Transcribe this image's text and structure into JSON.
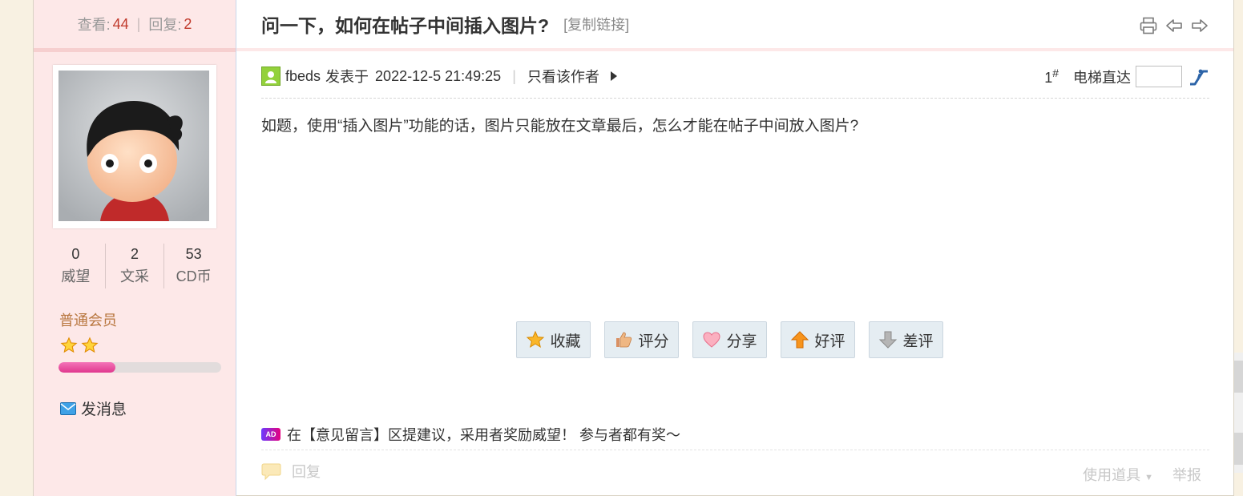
{
  "sidebar": {
    "views_label": "查看:",
    "views": "44",
    "replies_label": "回复:",
    "replies": "2",
    "stats": [
      {
        "value": "0",
        "label": "威望"
      },
      {
        "value": "2",
        "label": "文采"
      },
      {
        "value": "53",
        "label": "CD币"
      }
    ],
    "member_level": "普通会员",
    "stars": 2,
    "level_progress_percent": 35,
    "send_message": "发消息"
  },
  "thread": {
    "title": "问一下，如何在帖子中间插入图片?",
    "copy_link": "[复制链接]"
  },
  "post": {
    "author": "fbeds",
    "posted_prefix": "发表于",
    "posted_at": "2022-12-5 21:49:25",
    "only_author": "只看该作者",
    "floor": "1",
    "floor_mark": "#",
    "elevator": "电梯直达",
    "content": "如题，使用“插入图片”功能的话，图片只能放在文章最后，怎么才能在帖子中间放入图片?"
  },
  "actions": [
    {
      "label": "收藏",
      "icon": "star-icon",
      "color": "#f0a81c"
    },
    {
      "label": "评分",
      "icon": "thumbs-up-icon",
      "color": "#e0a26e"
    },
    {
      "label": "分享",
      "icon": "heart-icon",
      "color": "#f58ca5"
    },
    {
      "label": "好评",
      "icon": "arrow-up-icon",
      "color": "#f08a1a"
    },
    {
      "label": "差评",
      "icon": "arrow-down-icon",
      "color": "#9a9a9a"
    }
  ],
  "ad": {
    "badge": "AD",
    "text": "在【意见留言】区提建议，采用者奖励威望！ 参与者都有奖～"
  },
  "footer": {
    "reply": "回复",
    "use_tools": "使用道具",
    "report": "举报"
  }
}
